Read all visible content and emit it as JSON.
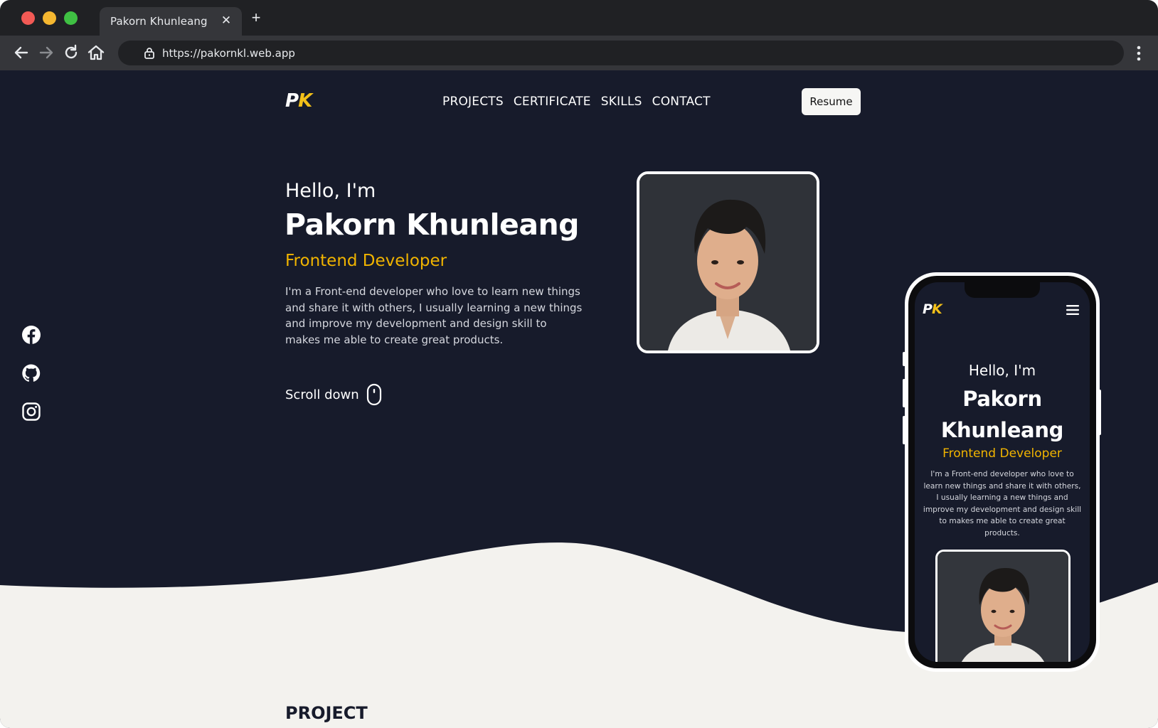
{
  "browser": {
    "tab_title": "Pakorn Khunleang",
    "tab_close_glyph": "✕",
    "new_tab_glyph": "+",
    "url": "https://pakornkl.web.app",
    "icons": [
      "back-icon",
      "forward-icon",
      "reload-icon",
      "home-icon",
      "lock-icon",
      "more-menu-icon"
    ]
  },
  "site": {
    "logo_p": "P",
    "logo_k": "K",
    "nav": [
      "PROJECTS",
      "CERTIFICATE",
      "SKILLS",
      "CONTACT"
    ],
    "resume_label": "Resume",
    "hello": "Hello, I'm",
    "name": "Pakorn Khunleang",
    "role": "Frontend Developer",
    "bio": "I'm a Front-end developer who love to learn new things and share it with others, I usually learning a new things and improve my development and design skill to makes me able to create great products.",
    "scroll_label": "Scroll down",
    "social_icons": [
      "facebook-icon",
      "github-icon",
      "instagram-icon"
    ],
    "section_heading": "PROJECT"
  },
  "phone": {
    "logo_p": "P",
    "logo_k": "K",
    "hello": "Hello, I'm",
    "name": "Pakorn Khunleang",
    "role": "Frontend Developer",
    "bio": "I'm a Front-end developer who love to learn new things and share it with others, I usually learning a new things and improve my development and design skill to makes me able to create great products.",
    "menu_icon": "hamburger-icon"
  },
  "colors": {
    "page_bg": "#171b2b",
    "accent": "#f1b400",
    "wave": "#f3f2ee"
  }
}
